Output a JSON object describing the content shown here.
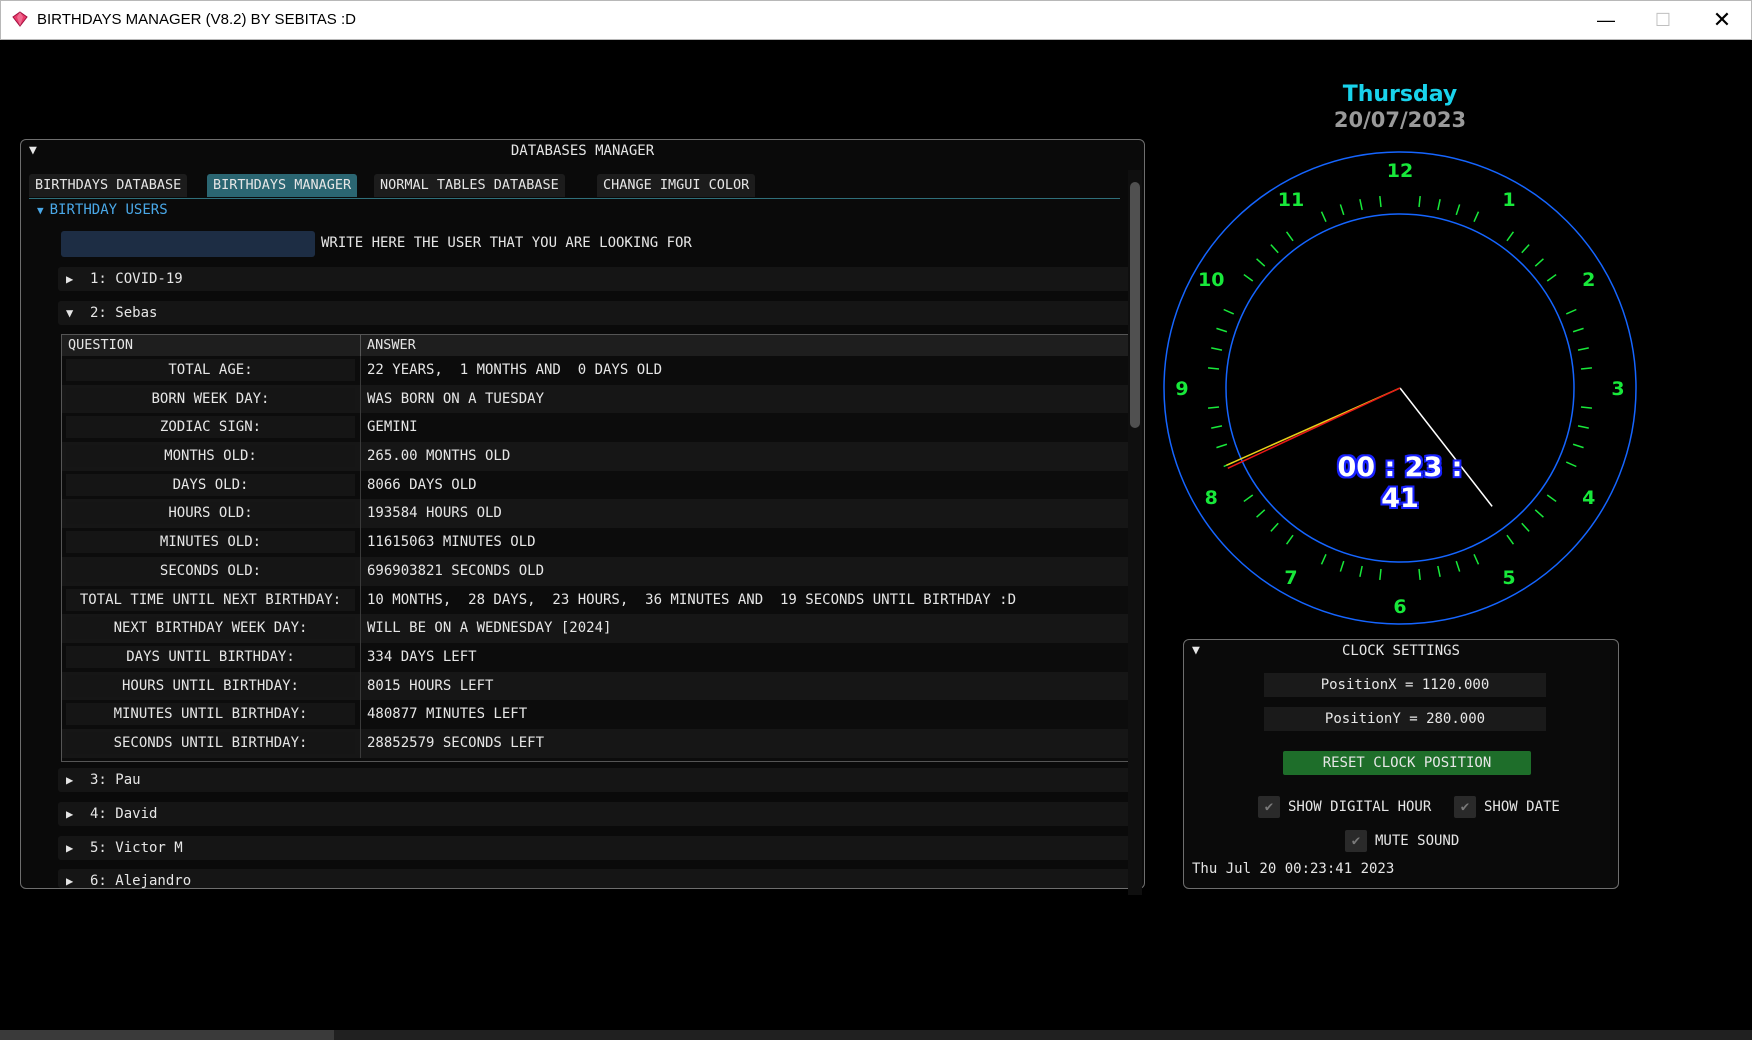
{
  "window": {
    "title": "BIRTHDAYS MANAGER (V8.2) BY SEBITAS :D",
    "min_glyph": "—",
    "max_glyph": "☐",
    "close_glyph": "✕"
  },
  "db_manager": {
    "title": "DATABASES MANAGER",
    "tabs": [
      {
        "label": "BIRTHDAYS DATABASE",
        "active": false
      },
      {
        "label": "BIRTHDAYS MANAGER",
        "active": true
      },
      {
        "label": "NORMAL TABLES DATABASE",
        "active": false
      },
      {
        "label": "CHANGE IMGUI COLOR",
        "active": false
      }
    ],
    "tree_header": "BIRTHDAY USERS",
    "search": {
      "value": "",
      "label": "WRITE HERE THE USER THAT YOU ARE LOOKING FOR"
    },
    "users": [
      {
        "label": "1: COVID-19",
        "expanded": false
      },
      {
        "label": "2: Sebas",
        "expanded": true
      },
      {
        "label": "3: Pau",
        "expanded": false
      },
      {
        "label": "4: David",
        "expanded": false
      },
      {
        "label": "5: Victor M",
        "expanded": false
      },
      {
        "label": "6: Alejandro",
        "expanded": false
      }
    ],
    "table": {
      "headers": [
        "QUESTION",
        "ANSWER"
      ],
      "rows": [
        {
          "q": "TOTAL AGE:",
          "a": "22 YEARS,  1 MONTHS AND  0 DAYS OLD"
        },
        {
          "q": "BORN WEEK DAY:",
          "a": "WAS BORN ON A TUESDAY"
        },
        {
          "q": "ZODIAC SIGN:",
          "a": "GEMINI"
        },
        {
          "q": "MONTHS OLD:",
          "a": "265.00 MONTHS OLD"
        },
        {
          "q": "DAYS OLD:",
          "a": "8066 DAYS OLD"
        },
        {
          "q": "HOURS OLD:",
          "a": "193584 HOURS OLD"
        },
        {
          "q": "MINUTES OLD:",
          "a": "11615063 MINUTES OLD"
        },
        {
          "q": "SECONDS OLD:",
          "a": "696903821 SECONDS OLD"
        },
        {
          "q": "TOTAL TIME UNTIL NEXT BIRTHDAY:",
          "a": "10 MONTHS,  28 DAYS,  23 HOURS,  36 MINUTES AND  19 SECONDS UNTIL BIRTHDAY :D"
        },
        {
          "q": "NEXT BIRTHDAY WEEK DAY:",
          "a": "WILL BE ON A WEDNESDAY [2024]"
        },
        {
          "q": "DAYS UNTIL BIRTHDAY:",
          "a": "334 DAYS LEFT"
        },
        {
          "q": "HOURS UNTIL BIRTHDAY:",
          "a": "8015 HOURS LEFT"
        },
        {
          "q": "MINUTES UNTIL BIRTHDAY:",
          "a": "480877 MINUTES LEFT"
        },
        {
          "q": "SECONDS UNTIL BIRTHDAY:",
          "a": "28852579 SECONDS LEFT"
        }
      ]
    }
  },
  "clock": {
    "day": "Thursday",
    "date": "20/07/2023",
    "digital": "00 : 23 : 41",
    "numbers": [
      "12",
      "1",
      "2",
      "3",
      "4",
      "5",
      "6",
      "7",
      "8",
      "9",
      "10",
      "11"
    ],
    "time": {
      "h": 0,
      "m": 23,
      "s": 41
    },
    "colors": {
      "ring": "#1565ff",
      "numbers": "#18e83a",
      "ticks": "#18e83a",
      "minute_hand": "#ffffff",
      "hour_hand": "#e81818",
      "second_hand": "#e8d018"
    }
  },
  "clock_settings": {
    "title": "CLOCK SETTINGS",
    "position_x": "PositionX = 1120.000",
    "position_y": "PositionY = 280.000",
    "reset_label": "RESET CLOCK POSITION",
    "show_digital_hour": {
      "label": "SHOW DIGITAL HOUR",
      "checked": true
    },
    "show_date": {
      "label": "SHOW DATE",
      "checked": true
    },
    "mute_sound": {
      "label": "MUTE SOUND",
      "checked": true
    },
    "datetime": "Thu Jul 20 00:23:41 2023"
  }
}
